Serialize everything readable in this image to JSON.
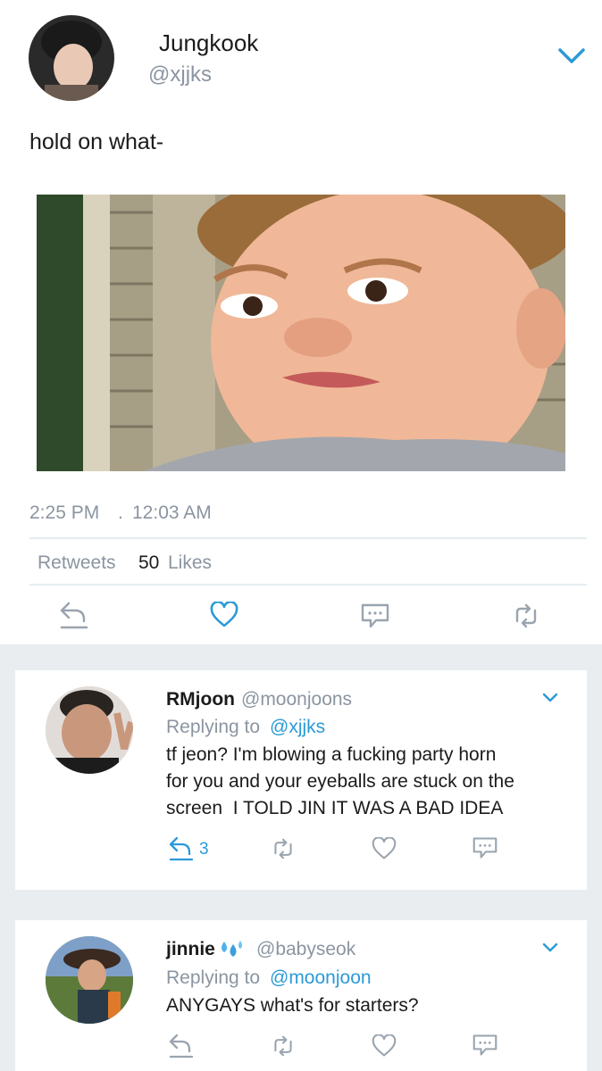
{
  "main_tweet": {
    "display_name": "Jungkook",
    "handle": "@xjjks",
    "text": "hold on what-",
    "time": "2:25 PM",
    "separator": ".",
    "date": "12:03 AM",
    "retweets_label": "Retweets",
    "likes_count": "50",
    "likes_label": "Likes"
  },
  "replies": [
    {
      "display_name": "RMjoon",
      "handle": "@moonjoons",
      "replying_prefix": "Replying to",
      "replying_to": "@xjjks",
      "text_lines": [
        "tf jeon? I'm blowing a fucking party horn",
        "for you and your eyeballs are stuck on the",
        "screen  I TOLD JIN IT WAS A BAD IDEA"
      ],
      "reply_count": "3"
    },
    {
      "display_name": "jinnie",
      "handle": "@babyseok",
      "replying_prefix": "Replying to",
      "replying_to": "@moonjoon",
      "text_lines": [
        "ANYGAYS what's for starters?"
      ],
      "reply_count": ""
    }
  ],
  "colors": {
    "accent": "#2b9ad7",
    "muted": "#8b95a1",
    "like_active": "#2b9ad7",
    "feed_background": "#e9edf0"
  },
  "icons": [
    "chevron-down-icon",
    "reply-icon",
    "heart-icon",
    "comment-icon",
    "retweet-icon",
    "droplets-emoji"
  ]
}
